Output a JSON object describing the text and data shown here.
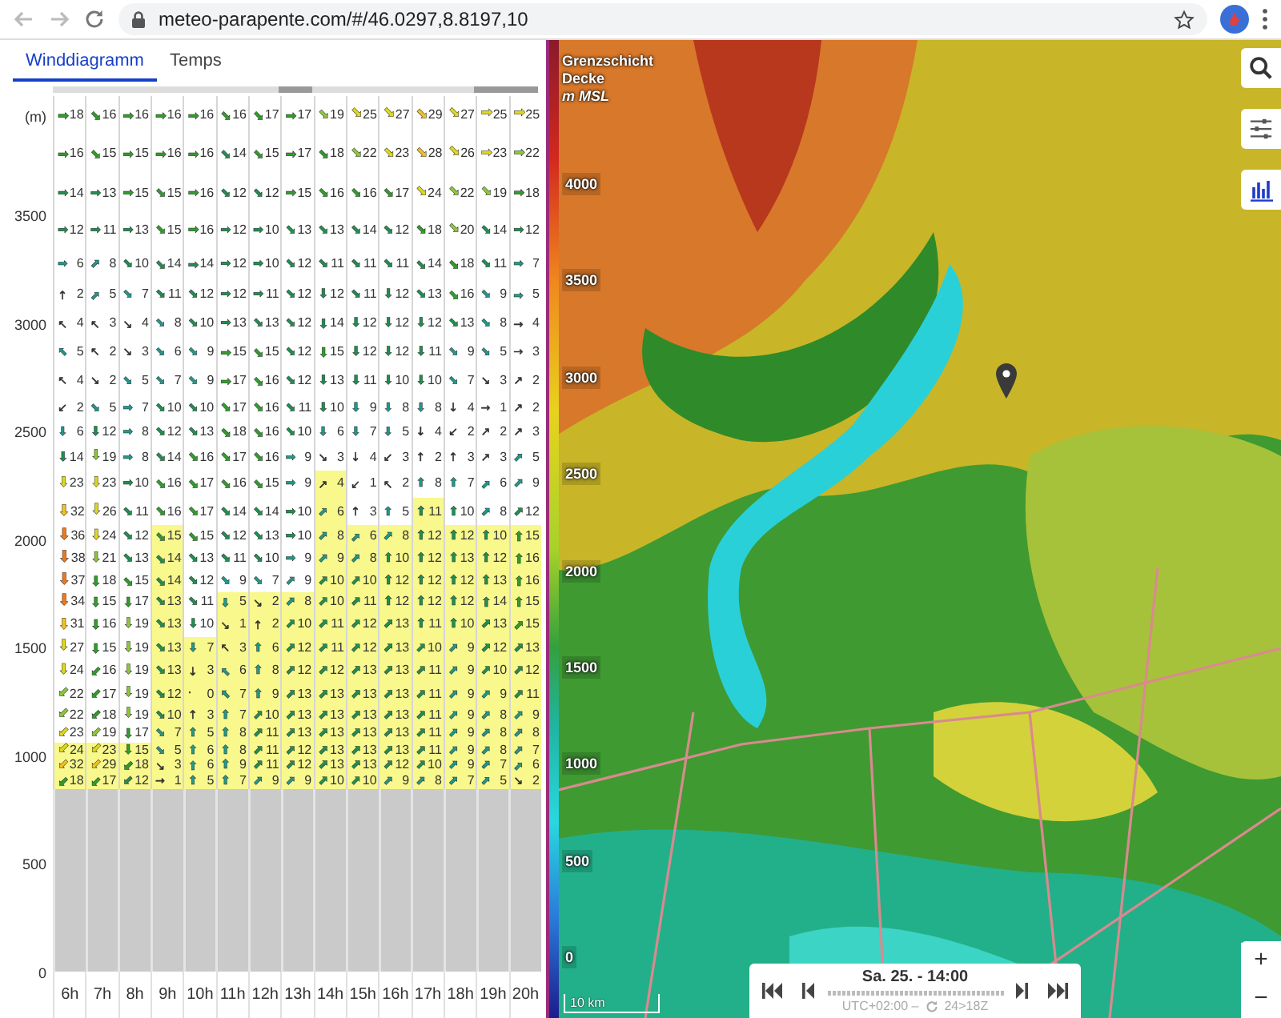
{
  "browser": {
    "url": "meteo-parapente.com/#/46.0297,8.8197,10"
  },
  "tabs": [
    {
      "label": "Winddiagramm",
      "selected": true
    },
    {
      "label": "Temps",
      "selected": false
    }
  ],
  "diagram": {
    "unit": "(m)",
    "altitude_labels": [
      "3500",
      "3000",
      "2500",
      "2000",
      "1500",
      "1000",
      "500",
      "0"
    ],
    "columns": [
      {
        "label": "6h",
        "cloud": false
      },
      {
        "label": "7h",
        "cloud": false
      },
      {
        "label": "8h",
        "cloud": false
      },
      {
        "label": "9h",
        "cloud": false
      },
      {
        "label": "10h",
        "cloud": false
      },
      {
        "label": "11h",
        "cloud": false
      },
      {
        "label": "12h",
        "cloud": false
      },
      {
        "label": "13h",
        "cloud": true
      },
      {
        "label": "14h",
        "cloud": false
      },
      {
        "label": "15h",
        "cloud": false
      },
      {
        "label": "16h",
        "cloud": false
      },
      {
        "label": "17h",
        "cloud": false
      },
      {
        "label": "18h",
        "cloud": false
      },
      {
        "label": "19h",
        "cloud": true
      },
      {
        "label": "20h",
        "cloud": true
      }
    ],
    "rows": [
      {
        "speeds": [
          "18",
          "16",
          "16",
          "16",
          "16",
          "16",
          "17",
          "17",
          "19",
          "25",
          "27",
          "29",
          "27",
          "25",
          "25"
        ],
        "arrows": [
          "➡",
          "⬊",
          "➡",
          "➡",
          "➡",
          "⬊",
          "⬊",
          "➡",
          "⬊",
          "⬊",
          "⬊",
          "⬊",
          "⬊",
          "➡",
          "➡"
        ],
        "thermal": [
          false,
          false,
          false,
          false,
          false,
          false,
          false,
          false,
          false,
          false,
          false,
          false,
          false,
          false,
          false
        ]
      },
      {
        "speeds": [
          "16",
          "15",
          "15",
          "16",
          "16",
          "14",
          "15",
          "17",
          "18",
          "22",
          "23",
          "28",
          "26",
          "23",
          "22"
        ],
        "arrows": [
          "➡",
          "⬊",
          "➡",
          "➡",
          "➡",
          "⬊",
          "⬊",
          "➡",
          "⬊",
          "⬊",
          "⬊",
          "⬊",
          "⬊",
          "➡",
          "➡"
        ],
        "thermal": [
          false,
          false,
          false,
          false,
          false,
          false,
          false,
          false,
          false,
          false,
          false,
          false,
          false,
          false,
          false
        ]
      },
      {
        "speeds": [
          "14",
          "13",
          "15",
          "15",
          "16",
          "12",
          "12",
          "15",
          "16",
          "16",
          "17",
          "24",
          "22",
          "19",
          "18"
        ],
        "arrows": [
          "➡",
          "➡",
          "➡",
          "⬊",
          "➡",
          "⬊",
          "⬊",
          "➡",
          "⬊",
          "⬊",
          "⬊",
          "⬊",
          "⬊",
          "⬊",
          "➡"
        ],
        "thermal": [
          false,
          false,
          false,
          false,
          false,
          false,
          false,
          false,
          false,
          false,
          false,
          false,
          false,
          false,
          false
        ]
      },
      {
        "speeds": [
          "12",
          "11",
          "13",
          "15",
          "16",
          "12",
          "10",
          "13",
          "13",
          "14",
          "12",
          "18",
          "20",
          "14",
          "12"
        ],
        "arrows": [
          "➡",
          "➡",
          "➡",
          "⬊",
          "➡",
          "➡",
          "➡",
          "⬊",
          "⬊",
          "⬊",
          "⬊",
          "⬊",
          "⬊",
          "⬊",
          "➡"
        ],
        "thermal": [
          false,
          false,
          false,
          false,
          false,
          false,
          false,
          false,
          false,
          false,
          false,
          false,
          false,
          false,
          false
        ]
      },
      {
        "speeds": [
          "6",
          "8",
          "10",
          "14",
          "14",
          "12",
          "10",
          "12",
          "11",
          "11",
          "11",
          "14",
          "18",
          "11",
          "7"
        ],
        "arrows": [
          "➡",
          "⬈",
          "⬊",
          "⬊",
          "➡",
          "➡",
          "➡",
          "⬊",
          "⬊",
          "⬊",
          "⬊",
          "⬊",
          "⬊",
          "⬊",
          "➡"
        ],
        "thermal": [
          false,
          false,
          false,
          false,
          false,
          false,
          false,
          false,
          false,
          false,
          false,
          false,
          false,
          false,
          false
        ]
      },
      {
        "speeds": [
          "2",
          "5",
          "7",
          "11",
          "12",
          "12",
          "11",
          "12",
          "12",
          "11",
          "12",
          "13",
          "16",
          "9",
          "5"
        ],
        "arrows": [
          "↑",
          "⬈",
          "⬊",
          "⬊",
          "⬊",
          "➡",
          "➡",
          "⬊",
          "⬇",
          "⬊",
          "⬇",
          "⬊",
          "⬊",
          "⬊",
          "➡"
        ],
        "thermal": [
          false,
          false,
          false,
          false,
          false,
          false,
          false,
          false,
          false,
          false,
          false,
          false,
          false,
          false,
          false
        ]
      },
      {
        "speeds": [
          "4",
          "3",
          "4",
          "8",
          "10",
          "13",
          "13",
          "12",
          "14",
          "12",
          "12",
          "12",
          "13",
          "8",
          "4"
        ],
        "arrows": [
          "↖",
          "↖",
          "↘",
          "⬊",
          "⬊",
          "➡",
          "⬊",
          "⬊",
          "⬇",
          "⬇",
          "⬇",
          "⬇",
          "⬊",
          "⬊",
          "→"
        ],
        "thermal": [
          false,
          false,
          false,
          false,
          false,
          false,
          false,
          false,
          false,
          false,
          false,
          false,
          false,
          false,
          false
        ]
      },
      {
        "speeds": [
          "5",
          "2",
          "3",
          "6",
          "9",
          "15",
          "15",
          "12",
          "15",
          "12",
          "12",
          "11",
          "9",
          "5",
          "3"
        ],
        "arrows": [
          "⬉",
          "↖",
          "↘",
          "⬊",
          "⬊",
          "➡",
          "⬊",
          "⬊",
          "⬇",
          "⬇",
          "⬇",
          "⬇",
          "⬊",
          "⬊",
          "→"
        ],
        "thermal": [
          false,
          false,
          false,
          false,
          false,
          false,
          false,
          false,
          false,
          false,
          false,
          false,
          false,
          false,
          false
        ]
      },
      {
        "speeds": [
          "4",
          "2",
          "5",
          "7",
          "9",
          "17",
          "16",
          "12",
          "13",
          "11",
          "10",
          "10",
          "7",
          "3",
          "2"
        ],
        "arrows": [
          "↖",
          "↘",
          "⬊",
          "⬊",
          "⬊",
          "➡",
          "⬊",
          "⬊",
          "⬇",
          "⬇",
          "⬇",
          "⬇",
          "⬊",
          "↘",
          "↗"
        ],
        "thermal": [
          false,
          false,
          false,
          false,
          false,
          false,
          false,
          false,
          false,
          false,
          false,
          false,
          false,
          false,
          false
        ]
      },
      {
        "speeds": [
          "2",
          "5",
          "7",
          "10",
          "10",
          "17",
          "16",
          "11",
          "10",
          "9",
          "8",
          "8",
          "4",
          "1",
          "2"
        ],
        "arrows": [
          "↙",
          "⬊",
          "➡",
          "⬊",
          "⬊",
          "⬊",
          "⬊",
          "⬊",
          "⬇",
          "⬇",
          "⬇",
          "⬇",
          "↓",
          "→",
          "↗"
        ],
        "thermal": [
          false,
          false,
          false,
          false,
          false,
          false,
          false,
          false,
          false,
          false,
          false,
          false,
          false,
          false,
          false
        ]
      },
      {
        "speeds": [
          "6",
          "12",
          "8",
          "12",
          "13",
          "18",
          "16",
          "10",
          "6",
          "7",
          "5",
          "4",
          "2",
          "2",
          "3"
        ],
        "arrows": [
          "⬇",
          "⬇",
          "➡",
          "⬊",
          "⬊",
          "⬊",
          "⬊",
          "⬊",
          "⬇",
          "⬇",
          "⬇",
          "↓",
          "↙",
          "↗",
          "↗"
        ],
        "thermal": [
          false,
          false,
          false,
          false,
          false,
          false,
          false,
          false,
          false,
          false,
          false,
          false,
          false,
          false,
          false
        ]
      },
      {
        "speeds": [
          "14",
          "19",
          "8",
          "14",
          "16",
          "17",
          "16",
          "9",
          "3",
          "4",
          "3",
          "2",
          "3",
          "3",
          "5"
        ],
        "arrows": [
          "⬇",
          "⬇",
          "➡",
          "⬊",
          "⬊",
          "⬊",
          "⬊",
          "➡",
          "↘",
          "↓",
          "↙",
          "↑",
          "↑",
          "↗",
          "⬈"
        ],
        "thermal": [
          false,
          false,
          false,
          false,
          false,
          false,
          false,
          false,
          false,
          false,
          false,
          false,
          false,
          false,
          false
        ]
      },
      {
        "speeds": [
          "23",
          "23",
          "10",
          "16",
          "17",
          "16",
          "15",
          "9",
          "4",
          "1",
          "2",
          "8",
          "7",
          "6",
          "9"
        ],
        "arrows": [
          "⬇",
          "⬇",
          "➡",
          "⬊",
          "⬊",
          "⬊",
          "⬊",
          "➡",
          "↗",
          "↙",
          "↖",
          "⬆",
          "⬆",
          "⬈",
          "⬈"
        ],
        "thermal": [
          false,
          false,
          false,
          false,
          false,
          false,
          false,
          false,
          true,
          false,
          false,
          false,
          false,
          false,
          false
        ]
      },
      {
        "speeds": [
          "32",
          "26",
          "11",
          "16",
          "17",
          "14",
          "14",
          "10",
          "6",
          "3",
          "5",
          "11",
          "10",
          "8",
          "12"
        ],
        "arrows": [
          "⬇",
          "⬇",
          "⬊",
          "⬊",
          "⬊",
          "⬊",
          "⬊",
          "➡",
          "⬈",
          "↑",
          "⬆",
          "⬆",
          "⬆",
          "⬈",
          "⬈"
        ],
        "thermal": [
          false,
          false,
          false,
          false,
          false,
          false,
          false,
          false,
          true,
          false,
          false,
          true,
          false,
          false,
          false
        ]
      },
      {
        "speeds": [
          "36",
          "24",
          "12",
          "15",
          "15",
          "12",
          "13",
          "10",
          "8",
          "6",
          "8",
          "12",
          "12",
          "10",
          "15"
        ],
        "arrows": [
          "⬇",
          "⬇",
          "⬊",
          "⬊",
          "⬊",
          "⬊",
          "⬊",
          "➡",
          "⬈",
          "⬈",
          "⬈",
          "⬆",
          "⬆",
          "⬆",
          "⬆"
        ],
        "thermal": [
          false,
          false,
          false,
          true,
          false,
          false,
          false,
          false,
          true,
          true,
          true,
          true,
          true,
          true,
          true
        ]
      },
      {
        "speeds": [
          "38",
          "21",
          "13",
          "14",
          "13",
          "11",
          "10",
          "9",
          "9",
          "8",
          "10",
          "12",
          "13",
          "12",
          "16"
        ],
        "arrows": [
          "⬇",
          "⬇",
          "⬊",
          "⬊",
          "⬊",
          "⬊",
          "⬊",
          "➡",
          "⬈",
          "⬈",
          "⬆",
          "⬆",
          "⬆",
          "⬆",
          "⬆"
        ],
        "thermal": [
          false,
          false,
          false,
          true,
          false,
          false,
          false,
          false,
          true,
          true,
          true,
          true,
          true,
          true,
          true
        ]
      },
      {
        "speeds": [
          "37",
          "18",
          "15",
          "14",
          "12",
          "9",
          "7",
          "9",
          "10",
          "10",
          "12",
          "12",
          "12",
          "13",
          "16"
        ],
        "arrows": [
          "⬇",
          "⬇",
          "⬊",
          "⬊",
          "⬊",
          "⬊",
          "⬊",
          "⬈",
          "⬈",
          "⬈",
          "⬆",
          "⬆",
          "⬆",
          "⬆",
          "⬆"
        ],
        "thermal": [
          false,
          false,
          false,
          true,
          false,
          false,
          false,
          false,
          true,
          true,
          true,
          true,
          true,
          true,
          true
        ]
      },
      {
        "speeds": [
          "34",
          "15",
          "17",
          "13",
          "11",
          "5",
          "2",
          "8",
          "10",
          "11",
          "12",
          "12",
          "12",
          "14",
          "15"
        ],
        "arrows": [
          "⬇",
          "⬇",
          "⬇",
          "⬊",
          "⬊",
          "⬇",
          "↘",
          "⬈",
          "⬈",
          "⬈",
          "⬆",
          "⬆",
          "⬆",
          "⬆",
          "⬆"
        ],
        "thermal": [
          false,
          false,
          false,
          true,
          false,
          true,
          true,
          true,
          true,
          true,
          true,
          true,
          true,
          true,
          true
        ]
      },
      {
        "speeds": [
          "31",
          "16",
          "19",
          "13",
          "10",
          "1",
          "2",
          "10",
          "11",
          "12",
          "13",
          "11",
          "10",
          "13",
          "15"
        ],
        "arrows": [
          "⬇",
          "⬇",
          "⬇",
          "⬊",
          "⬇",
          "↘",
          "↑",
          "⬈",
          "⬈",
          "⬈",
          "⬈",
          "⬆",
          "⬆",
          "⬈",
          "⬈"
        ],
        "thermal": [
          false,
          false,
          false,
          true,
          false,
          true,
          true,
          true,
          true,
          true,
          true,
          true,
          true,
          true,
          true
        ]
      },
      {
        "speeds": [
          "27",
          "15",
          "19",
          "13",
          "7",
          "3",
          "6",
          "12",
          "11",
          "12",
          "13",
          "10",
          "9",
          "12",
          "13"
        ],
        "arrows": [
          "⬇",
          "⬇",
          "⬇",
          "⬊",
          "⬇",
          "↖",
          "⬆",
          "⬈",
          "⬈",
          "⬈",
          "⬈",
          "⬈",
          "⬈",
          "⬈",
          "⬈"
        ],
        "thermal": [
          false,
          false,
          false,
          true,
          true,
          true,
          true,
          true,
          true,
          true,
          true,
          true,
          true,
          true,
          true
        ]
      },
      {
        "speeds": [
          "24",
          "16",
          "19",
          "13",
          "3",
          "6",
          "8",
          "12",
          "12",
          "13",
          "13",
          "11",
          "9",
          "10",
          "12"
        ],
        "arrows": [
          "⬇",
          "⬋",
          "⬇",
          "⬊",
          "↓",
          "⬉",
          "⬆",
          "⬈",
          "⬈",
          "⬈",
          "⬈",
          "⬈",
          "⬈",
          "⬈",
          "⬈"
        ],
        "thermal": [
          false,
          false,
          false,
          true,
          true,
          true,
          true,
          true,
          true,
          true,
          true,
          true,
          true,
          true,
          true
        ]
      },
      {
        "speeds": [
          "22",
          "17",
          "19",
          "12",
          "0",
          "7",
          "9",
          "13",
          "13",
          "13",
          "13",
          "11",
          "9",
          "9",
          "11"
        ],
        "arrows": [
          "⬋",
          "⬋",
          "⬇",
          "⬊",
          "·",
          "⬉",
          "⬆",
          "⬈",
          "⬈",
          "⬈",
          "⬈",
          "⬈",
          "⬈",
          "⬈",
          "⬈"
        ],
        "thermal": [
          false,
          false,
          false,
          true,
          true,
          true,
          true,
          true,
          true,
          true,
          true,
          true,
          true,
          true,
          true
        ]
      },
      {
        "speeds": [
          "22",
          "18",
          "19",
          "10",
          "3",
          "7",
          "10",
          "13",
          "13",
          "13",
          "13",
          "11",
          "9",
          "8",
          "9"
        ],
        "arrows": [
          "⬋",
          "⬋",
          "⬇",
          "⬊",
          "↑",
          "⬆",
          "⬈",
          "⬈",
          "⬈",
          "⬈",
          "⬈",
          "⬈",
          "⬈",
          "⬈",
          "⬈"
        ],
        "thermal": [
          false,
          false,
          false,
          true,
          true,
          true,
          true,
          true,
          true,
          true,
          true,
          true,
          true,
          true,
          true
        ]
      },
      {
        "speeds": [
          "23",
          "19",
          "17",
          "7",
          "5",
          "8",
          "11",
          "13",
          "13",
          "13",
          "13",
          "11",
          "9",
          "8",
          "8"
        ],
        "arrows": [
          "⬋",
          "⬋",
          "⬇",
          "⬊",
          "⬆",
          "⬆",
          "⬈",
          "⬈",
          "⬈",
          "⬈",
          "⬈",
          "⬈",
          "⬈",
          "⬈",
          "⬈"
        ],
        "thermal": [
          false,
          false,
          false,
          true,
          true,
          true,
          true,
          true,
          true,
          true,
          true,
          true,
          true,
          true,
          true
        ]
      },
      {
        "speeds": [
          "24",
          "23",
          "15",
          "5",
          "6",
          "8",
          "11",
          "12",
          "13",
          "13",
          "13",
          "11",
          "9",
          "8",
          "7"
        ],
        "arrows": [
          "⬋",
          "⬋",
          "⬇",
          "⬊",
          "⬆",
          "⬆",
          "⬈",
          "⬈",
          "⬈",
          "⬈",
          "⬈",
          "⬈",
          "⬈",
          "⬈",
          "⬈"
        ],
        "thermal": [
          true,
          true,
          true,
          true,
          true,
          true,
          true,
          true,
          true,
          true,
          true,
          true,
          true,
          true,
          true
        ]
      },
      {
        "speeds": [
          "32",
          "29",
          "18",
          "3",
          "6",
          "9",
          "11",
          "12",
          "13",
          "13",
          "12",
          "10",
          "9",
          "7",
          "6"
        ],
        "arrows": [
          "⬋",
          "⬋",
          "⬋",
          "↘",
          "⬆",
          "⬆",
          "⬈",
          "⬈",
          "⬈",
          "⬈",
          "⬈",
          "⬈",
          "⬈",
          "⬈",
          "⬈"
        ],
        "thermal": [
          true,
          true,
          true,
          true,
          true,
          true,
          true,
          true,
          true,
          true,
          true,
          true,
          true,
          true,
          true
        ]
      },
      {
        "speeds": [
          "18",
          "17",
          "12",
          "1",
          "5",
          "7",
          "9",
          "9",
          "10",
          "10",
          "9",
          "8",
          "7",
          "5",
          "2"
        ],
        "arrows": [
          "⬋",
          "⬋",
          "⬋",
          "→",
          "⬆",
          "⬆",
          "⬈",
          "⬈",
          "⬈",
          "⬈",
          "⬈",
          "⬈",
          "⬈",
          "⬈",
          "↘"
        ],
        "thermal": [
          true,
          true,
          true,
          true,
          true,
          true,
          true,
          true,
          true,
          true,
          true,
          true,
          true,
          true,
          true
        ]
      }
    ]
  },
  "map": {
    "kind": "picture",
    "legend": {
      "title": [
        "Grenzschicht",
        "Decke",
        "*m MSL*"
      ],
      "ticks": [
        "4000",
        "3500",
        "3000",
        "2500",
        "2000",
        "1500",
        "1000",
        "500",
        "0"
      ]
    },
    "scale": "10 km",
    "time_control": {
      "time": "Sa. 25. - 14:00",
      "timezone": "UTC+02:00 –",
      "run": "24>18Z"
    },
    "zoom_in": "+",
    "zoom_out": "−"
  }
}
